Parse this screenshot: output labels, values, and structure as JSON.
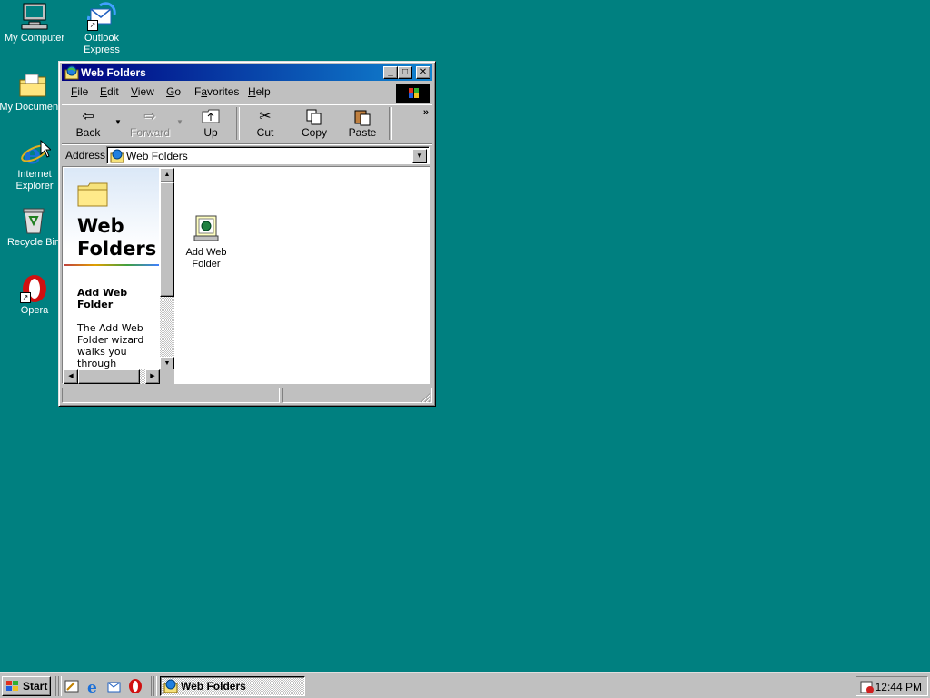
{
  "desktop": {
    "icons": [
      {
        "label": "My Computer"
      },
      {
        "label": "Outlook\nExpress"
      },
      {
        "label": "My Documents"
      },
      {
        "label": "Internet\nExplorer"
      },
      {
        "label": "Recycle Bin"
      },
      {
        "label": "Opera"
      }
    ]
  },
  "window": {
    "title": "Web Folders",
    "menu": [
      "File",
      "Edit",
      "View",
      "Go",
      "Favorites",
      "Help"
    ],
    "menu_access_keys": [
      "F",
      "E",
      "V",
      "G",
      "a",
      "H"
    ],
    "toolbar": {
      "back": "Back",
      "forward": "Forward",
      "up": "Up",
      "cut": "Cut",
      "copy": "Copy",
      "paste": "Paste"
    },
    "address": {
      "label": "Address",
      "value": "Web Folders"
    },
    "left_pane": {
      "title": "Web Folders",
      "subtitle": "Add Web Folder",
      "description": "The Add Web Folder wizard walks you through"
    },
    "items": [
      {
        "label": "Add Web Folder"
      }
    ]
  },
  "taskbar": {
    "start": "Start",
    "tasks": [
      {
        "label": "Web Folders",
        "active": true
      }
    ],
    "clock": "12:44 PM"
  },
  "colors": {
    "desktop": "#008080",
    "titlebar_start": "#000080",
    "titlebar_end": "#1084d0",
    "face": "#c0c0c0"
  }
}
